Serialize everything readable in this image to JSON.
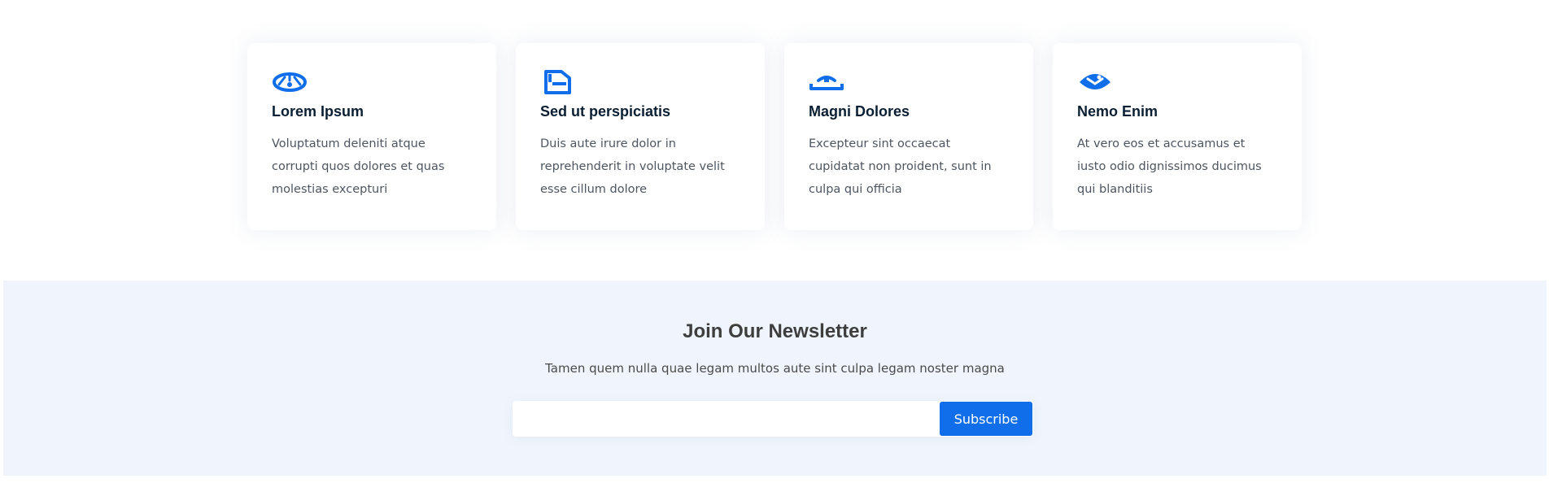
{
  "theme": {
    "accent": "#106eea",
    "newsletter_bg": "#f0f5fd"
  },
  "cards": [
    {
      "icon": "eye-outline-icon",
      "title": "Lorem Ipsum",
      "text": "Voluptatum deleniti atque corrupti quos dolores et quas molestias excepturi"
    },
    {
      "icon": "file-icon",
      "title": "Sed ut perspiciatis",
      "text": "Duis aute irure dolor in reprehenderit in voluptate velit esse cillum dolore"
    },
    {
      "icon": "tachometer-icon",
      "title": "Magni Dolores",
      "text": "Excepteur sint occaecat cupidatat non proident, sunt in culpa qui officia"
    },
    {
      "icon": "world-eye-icon",
      "title": "Nemo Enim",
      "text": "At vero eos et accusamus et iusto odio dignissimos ducimus qui blanditiis"
    }
  ],
  "newsletter": {
    "title": "Join Our Newsletter",
    "subtitle": "Tamen quem nulla quae legam multos aute sint culpa legam noster magna",
    "email_value": "",
    "email_placeholder": "",
    "subscribe_label": "Subscribe"
  }
}
